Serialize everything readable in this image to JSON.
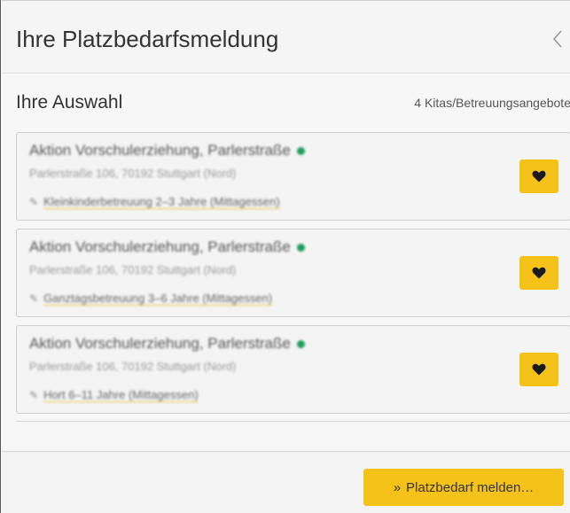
{
  "panel": {
    "title": "Ihre Platzbedarfsmeldung",
    "collapse_icon": "chevron-left-icon"
  },
  "selection": {
    "title": "Ihre Auswahl",
    "count_label": "4 Kitas/Betreuungsangebote",
    "items": [
      {
        "name": "Aktion Vorschulerziehung, Parlerstraße",
        "address": "Parlerstraße 106, 70192 Stuttgart (Nord)",
        "offer": "Kleinkinderbetreuung 2–3 Jahre (Mittagessen)",
        "status_color": "#1f9d5a",
        "favorite_icon": "heart-icon"
      },
      {
        "name": "Aktion Vorschulerziehung, Parlerstraße",
        "address": "Parlerstraße 106, 70192 Stuttgart (Nord)",
        "offer": "Ganztagsbetreuung 3–6 Jahre (Mittagessen)",
        "status_color": "#1f9d5a",
        "favorite_icon": "heart-icon"
      },
      {
        "name": "Aktion Vorschulerziehung, Parlerstraße",
        "address": "Parlerstraße 106, 70192 Stuttgart (Nord)",
        "offer": "Hort 6–11 Jahre (Mittagessen)",
        "status_color": "#1f9d5a",
        "favorite_icon": "heart-icon"
      }
    ]
  },
  "footer": {
    "submit_label": "Platzbedarf melden…",
    "submit_icon": "double-chevron-right-icon"
  },
  "colors": {
    "accent": "#f5c21a",
    "status_open": "#1f9d5a"
  }
}
